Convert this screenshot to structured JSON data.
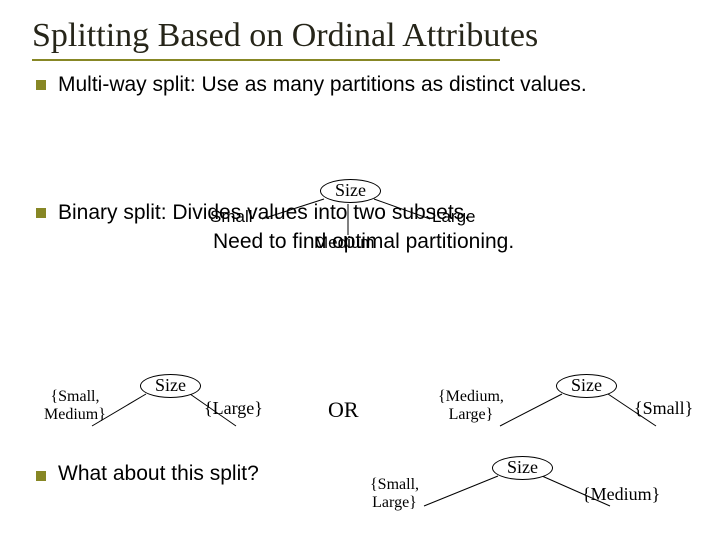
{
  "title": "Splitting Based on Ordinal Attributes",
  "bullet1": {
    "lead": "Multi-way split:",
    "rest": " Use as many partitions as distinct values."
  },
  "bullet2": {
    "lead": "Binary split:",
    "rest_line1": "  Divides values into two subsets.",
    "rest_line2": "Need to find optimal partitioning."
  },
  "bullet3": "What about this split?",
  "tree_multi": {
    "node": "Size",
    "left": "Small",
    "mid": "Medium",
    "right": "Large"
  },
  "tree_b1": {
    "node": "Size",
    "left": "{Small,\nMedium}",
    "right": "{Large}"
  },
  "or_label": "OR",
  "tree_b2": {
    "node": "Size",
    "left": "{Medium,\nLarge}",
    "right": "{Small}"
  },
  "tree_b3": {
    "node": "Size",
    "left": "{Small,\nLarge}",
    "right": "{Medium}"
  }
}
